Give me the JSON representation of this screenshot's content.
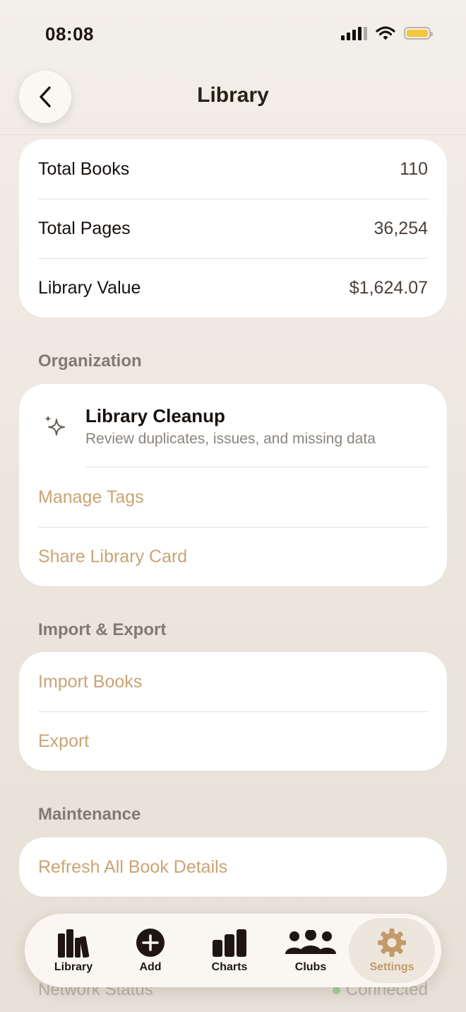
{
  "status_bar": {
    "time": "08:08"
  },
  "nav": {
    "title": "Library",
    "back_icon": "chevron-left-icon"
  },
  "stats": [
    {
      "label": "Total Books",
      "value": "110"
    },
    {
      "label": "Total Pages",
      "value": "36,254"
    },
    {
      "label": "Library Value",
      "value": "$1,624.07"
    }
  ],
  "organization": {
    "header": "Organization",
    "cleanup": {
      "title": "Library Cleanup",
      "subtitle": "Review duplicates, issues, and missing data",
      "icon": "sparkles-icon"
    },
    "manage_tags": "Manage Tags",
    "share_card": "Share Library Card"
  },
  "import_export": {
    "header": "Import & Export",
    "import_books": "Import Books",
    "export": "Export"
  },
  "maintenance": {
    "header": "Maintenance",
    "refresh": "Refresh All Book Details"
  },
  "peek": {
    "network_status": "Network Status",
    "connected": "Connected"
  },
  "tab_bar": {
    "tabs": [
      {
        "label": "Library",
        "icon": "books-icon"
      },
      {
        "label": "Add",
        "icon": "plus-circle-icon"
      },
      {
        "label": "Charts",
        "icon": "bar-chart-icon"
      },
      {
        "label": "Clubs",
        "icon": "people-icon"
      },
      {
        "label": "Settings",
        "icon": "gear-icon"
      }
    ],
    "active": "Settings"
  },
  "colors": {
    "accent": "#c9a474",
    "active_tab": "#c49a68",
    "battery": "#f4c63d"
  }
}
